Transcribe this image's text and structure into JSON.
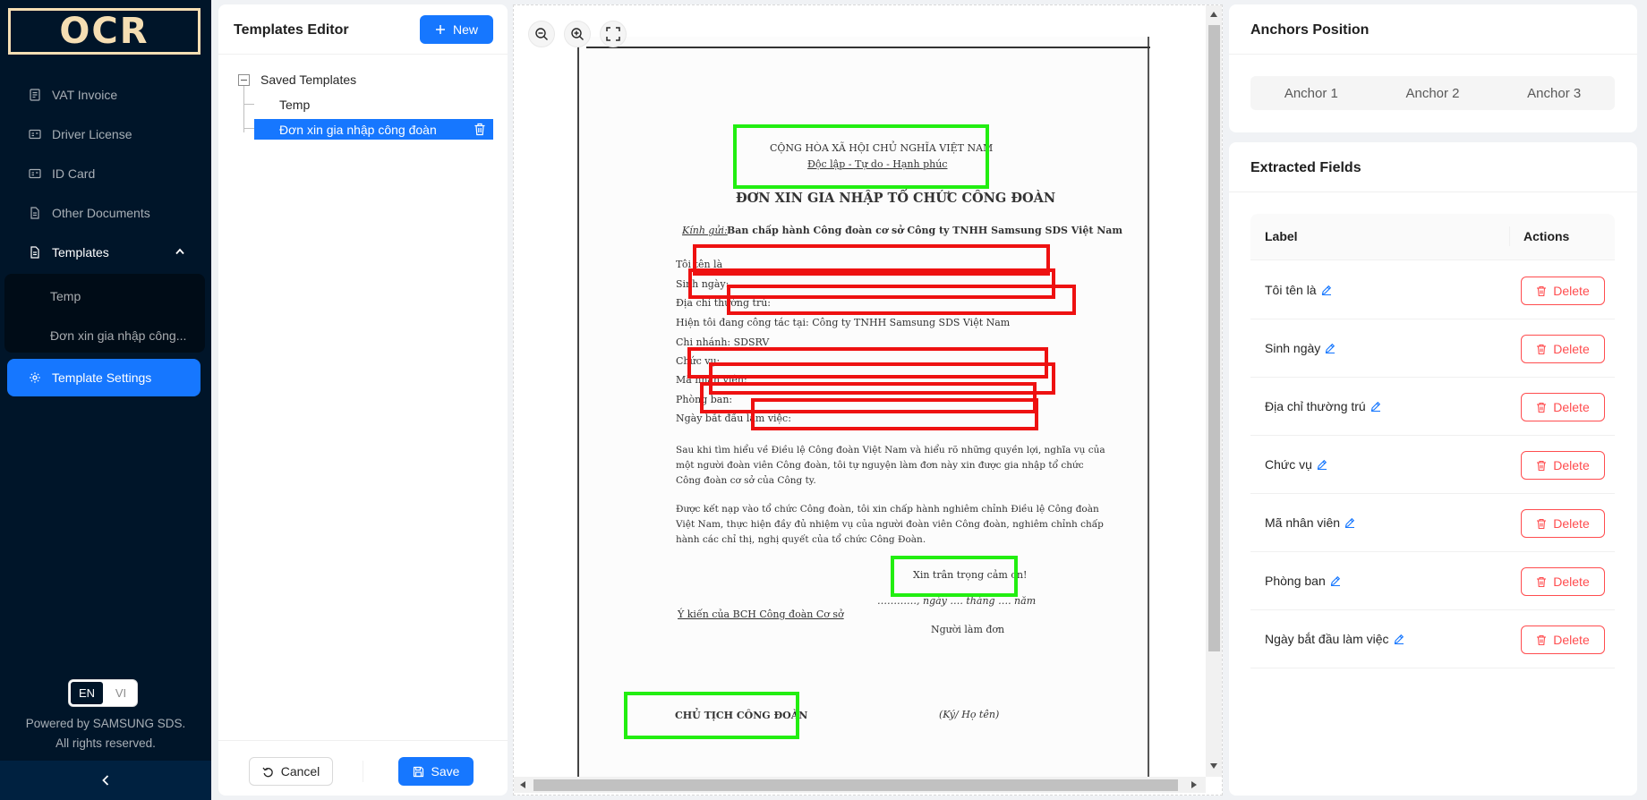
{
  "app": {
    "logo": "OCR"
  },
  "sidebar": {
    "items": [
      {
        "label": "VAT Invoice",
        "icon": "invoice-icon"
      },
      {
        "label": "Driver License",
        "icon": "id-card-icon"
      },
      {
        "label": "ID Card",
        "icon": "id-card-icon"
      },
      {
        "label": "Other Documents",
        "icon": "file-icon"
      },
      {
        "label": "Templates",
        "icon": "file-icon",
        "expanded": true
      },
      {
        "label": "Template Settings",
        "icon": "gear-icon",
        "selected": true
      }
    ],
    "sub_items": [
      {
        "label": "Temp"
      },
      {
        "label": "Đơn xin gia nhập công..."
      }
    ],
    "lang": {
      "en": "EN",
      "vi": "VI",
      "active": "EN"
    },
    "footer": {
      "line1": "Powered by SAMSUNG SDS.",
      "line2": "All rights reserved."
    }
  },
  "editor": {
    "title": "Templates Editor",
    "new_label": "New",
    "tree": {
      "root": "Saved Templates",
      "children": [
        "Temp",
        "Đơn xin gia nhập công đoàn"
      ],
      "selected_index": 1
    },
    "cancel_label": "Cancel",
    "save_label": "Save"
  },
  "document": {
    "header1": "CỘNG HÒA XÃ HỘI CHỦ NGHĨA VIỆT NAM",
    "header2": "Độc lập - Tự do - Hạnh phúc",
    "title": "ĐƠN XIN GIA NHẬP TỔ CHỨC CÔNG ĐOÀN",
    "addressee_prefix": "Kính gửi:",
    "addressee": "Ban chấp hành Công đoàn cơ sở Công ty TNHH Samsung SDS Việt Nam",
    "lines": [
      "Tôi tên là",
      "Sinh ngày:",
      "Địa chỉ thường trú:",
      "Hiện tôi đang công tác tại: Công ty TNHH Samsung SDS Việt Nam",
      "Chi nhánh: SDSRV",
      "Chức vụ:",
      "Mã nhân viên:",
      "Phòng ban:",
      "Ngày bắt đầu làm việc:"
    ],
    "para1": [
      "Sau khi tìm hiểu về Điều lệ Công đoàn Việt Nam và hiểu rõ những quyền lợi, nghĩa vụ của",
      "một người đoàn viên Công đoàn, tôi tự nguyện làm đơn này xin được gia nhập tổ chức",
      "Công đoàn cơ sở của Công ty."
    ],
    "para2": [
      "Được kết nạp vào tổ chức Công đoàn, tôi xin chấp hành nghiêm chỉnh Điều lệ Công đoàn",
      "Việt Nam, thực hiện đầy đủ nhiệm vụ của người đoàn viên Công đoàn, nghiêm chỉnh chấp",
      "hành các chỉ thị, nghị quyết của tổ chức Công Đoàn."
    ],
    "thanks": "Xin trân trọng cảm ơn!",
    "date_line": "…………, ngày …. tháng …. năm",
    "opinion": "Ý kiến của BCH Công đoàn Cơ sở",
    "applicant": "Người làm đơn",
    "chairman": "CHỦ TỊCH CÔNG ĐOÀN",
    "sign": "(Ký/ Họ tên)"
  },
  "colors": {
    "anchor_box": "#22ee11",
    "field_box": "#ee1111",
    "primary": "#1677ff",
    "danger": "#ff4d4f"
  },
  "anchors": {
    "title": "Anchors Position",
    "tabs": [
      "Anchor 1",
      "Anchor 2",
      "Anchor 3"
    ]
  },
  "fields": {
    "title": "Extracted Fields",
    "col_label": "Label",
    "col_actions": "Actions",
    "delete_label": "Delete",
    "rows": [
      "Tôi tên là",
      "Sinh ngày",
      "Địa chỉ thường trú",
      "Chức vụ",
      "Mã nhân viên",
      "Phòng ban",
      "Ngày bắt đầu làm việc"
    ]
  }
}
